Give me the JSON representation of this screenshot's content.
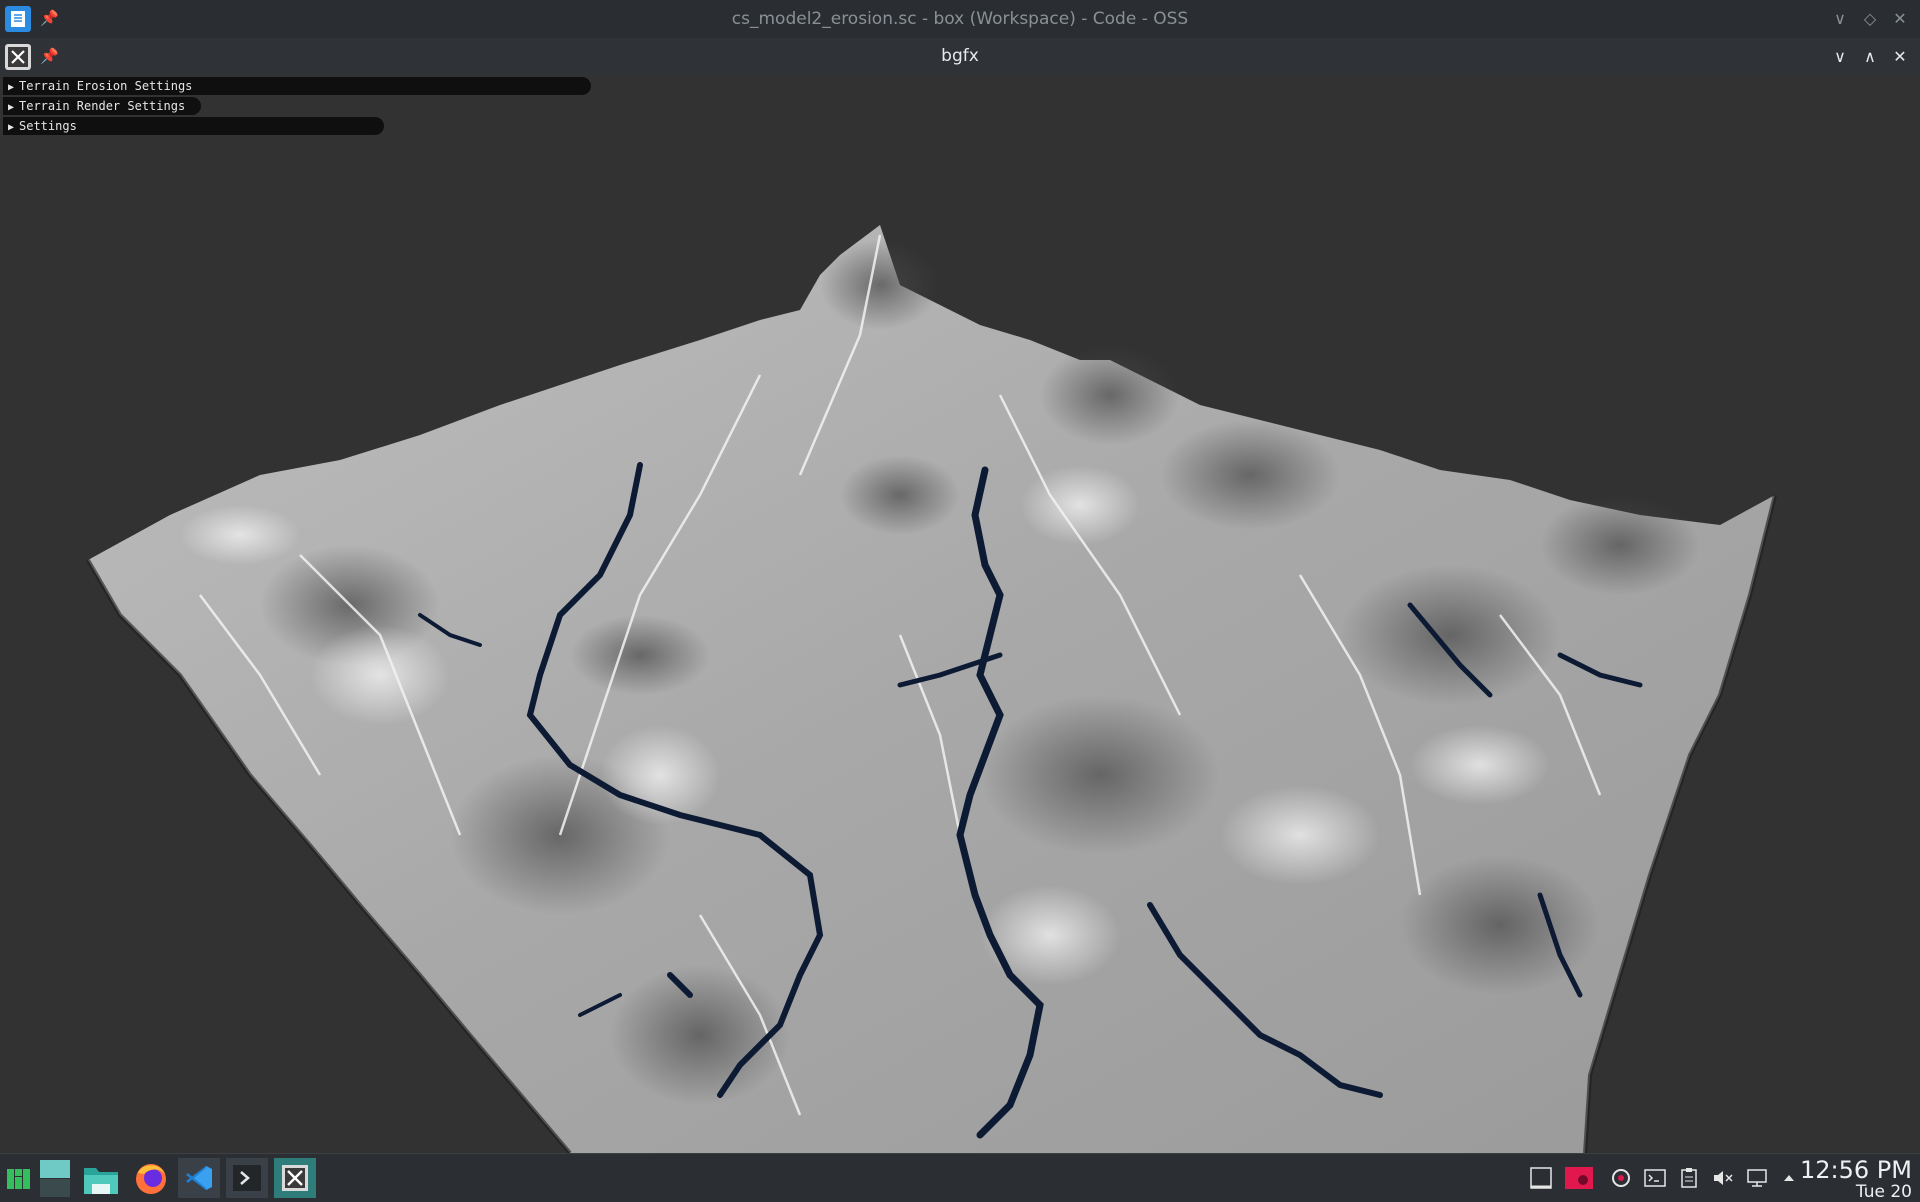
{
  "back_window": {
    "title": "cs_model2_erosion.sc - box (Workspace) - Code - OSS",
    "icon": "text-editor-icon",
    "pin_icon": "pin-icon",
    "buttons": [
      "minimize-chevron-icon",
      "restore-diamond-icon",
      "close-icon"
    ]
  },
  "front_window": {
    "title": "bgfx",
    "icon": "bgfx-app-icon",
    "pin_icon": "pin-icon",
    "buttons": [
      "minimize-chevron-icon",
      "maximize-chevron-icon",
      "close-icon"
    ]
  },
  "imgui_headers": [
    {
      "label": "Terrain Erosion Settings"
    },
    {
      "label": "Terrain Render Settings"
    },
    {
      "label": "Settings"
    }
  ],
  "taskbar": {
    "launchers": [
      "manjaro-menu-icon",
      "desktop-pager-icon",
      "file-manager-icon",
      "firefox-icon",
      "vscode-icon",
      "terminal-icon",
      "bgfx-app-icon"
    ],
    "tray": [
      "display-icon",
      "warning-app-icon",
      "update-icon",
      "terminal-tray-icon",
      "clipboard-icon",
      "volume-muted-icon",
      "network-icon",
      "expand-tray-icon"
    ],
    "clock": {
      "time": "12:56 PM",
      "date": "Tue 20"
    }
  },
  "colors": {
    "titlebar": "#2a2e32",
    "viewport": "#323232",
    "terrain_light": "#d8d8d8",
    "terrain_dark": "#5a5a5a",
    "water": "#0c1a33",
    "accent": "#1d99f3"
  }
}
